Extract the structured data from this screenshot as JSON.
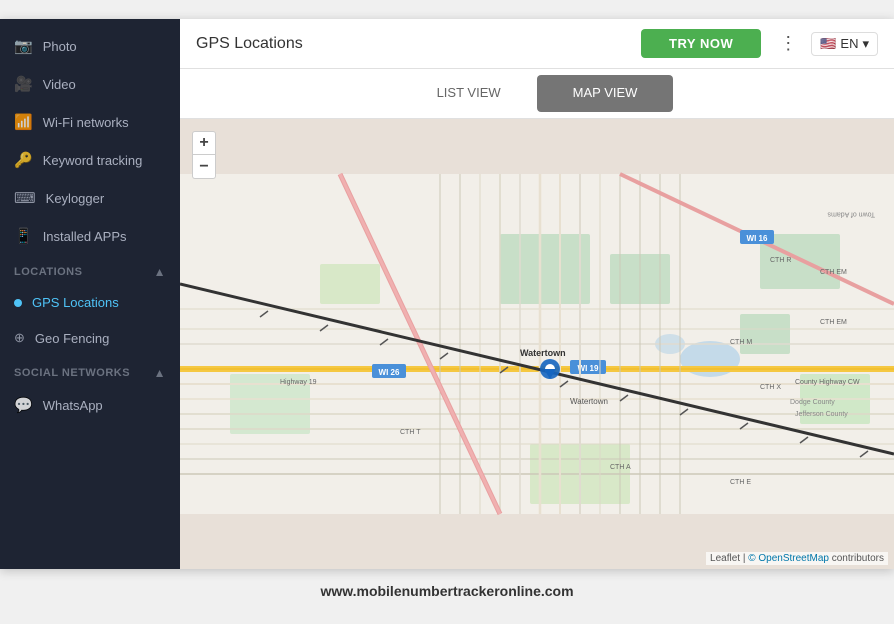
{
  "sidebar": {
    "items": [
      {
        "label": "Photo",
        "icon": "📷",
        "id": "photo"
      },
      {
        "label": "Video",
        "icon": "🎥",
        "id": "video"
      },
      {
        "label": "Wi-Fi networks",
        "icon": "📶",
        "id": "wifi"
      },
      {
        "label": "Keyword tracking",
        "icon": "🔑",
        "id": "keyword"
      },
      {
        "label": "Keylogger",
        "icon": "⌨",
        "id": "keylogger"
      },
      {
        "label": "Installed APPs",
        "icon": "📱",
        "id": "apps"
      }
    ],
    "locations_section": "LOCATIONS",
    "locations_items": [
      {
        "label": "GPS Locations",
        "id": "gps",
        "active": true
      },
      {
        "label": "Geo Fencing",
        "id": "geo"
      }
    ],
    "social_section": "SOCIAL NETWORKS",
    "social_items": [
      {
        "label": "WhatsApp",
        "id": "whatsapp"
      }
    ]
  },
  "header": {
    "title": "GPS Locations",
    "try_now_label": "TRY NOW"
  },
  "tabs": [
    {
      "label": "LIST VIEW",
      "id": "list",
      "active": false
    },
    {
      "label": "MAP VIEW",
      "id": "map",
      "active": true
    }
  ],
  "map": {
    "attribution_leaflet": "Leaflet",
    "attribution_osm": "© OpenStreetMap",
    "attribution_contributors": " contributors"
  },
  "zoom": {
    "plus": "+",
    "minus": "−"
  },
  "footer": {
    "url": "www.mobilenumbertrackeronline.com"
  },
  "lang": {
    "code": "EN",
    "chevron": "▾"
  }
}
